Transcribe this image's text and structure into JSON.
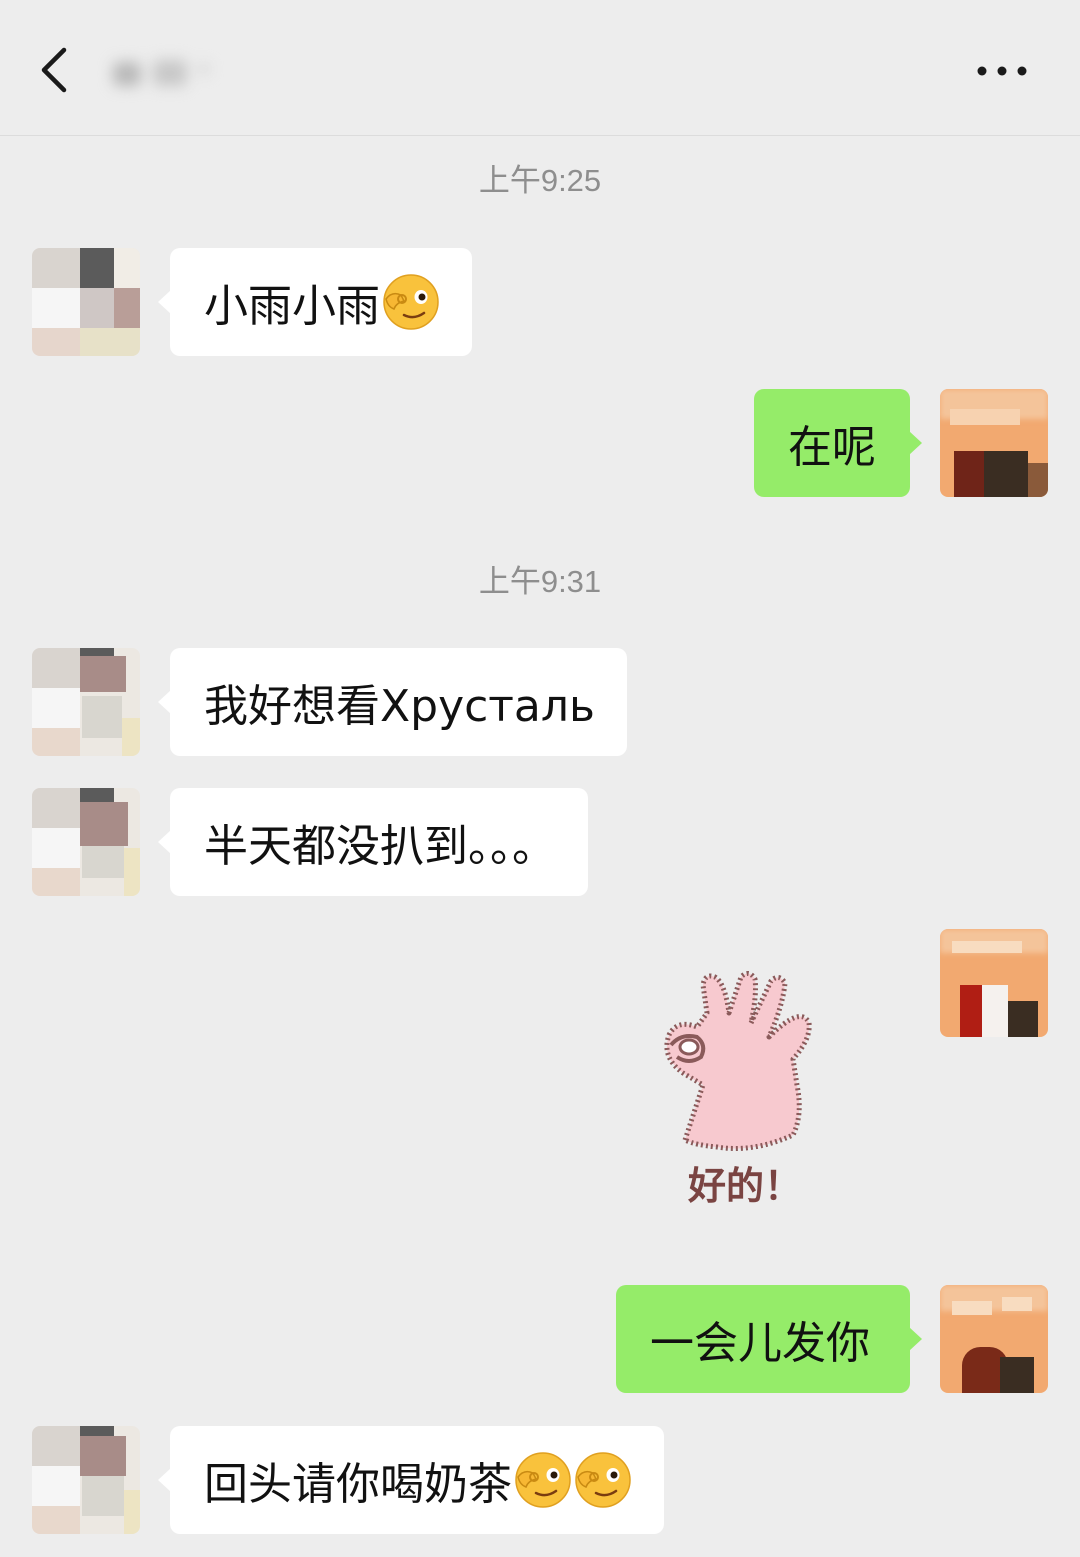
{
  "header": {
    "back_icon": "chevron-left-icon",
    "more_icon": "more-dots-icon"
  },
  "messages": {
    "ts1": "上午9:25",
    "m1": "小雨小雨",
    "m2": "在呢",
    "ts2": "上午9:31",
    "m3": "我好想看Хрусталь",
    "m4": "半天都没扒到。。。",
    "sticker": {
      "icon": "ok-hand-sticker",
      "caption": "好的！"
    },
    "m5": "一会儿发你",
    "m6": "回头请你喝奶茶"
  },
  "colors": {
    "background": "#ededed",
    "bubble_them": "#ffffff",
    "bubble_me": "#95ec69",
    "timestamp": "#8e8e8e"
  }
}
